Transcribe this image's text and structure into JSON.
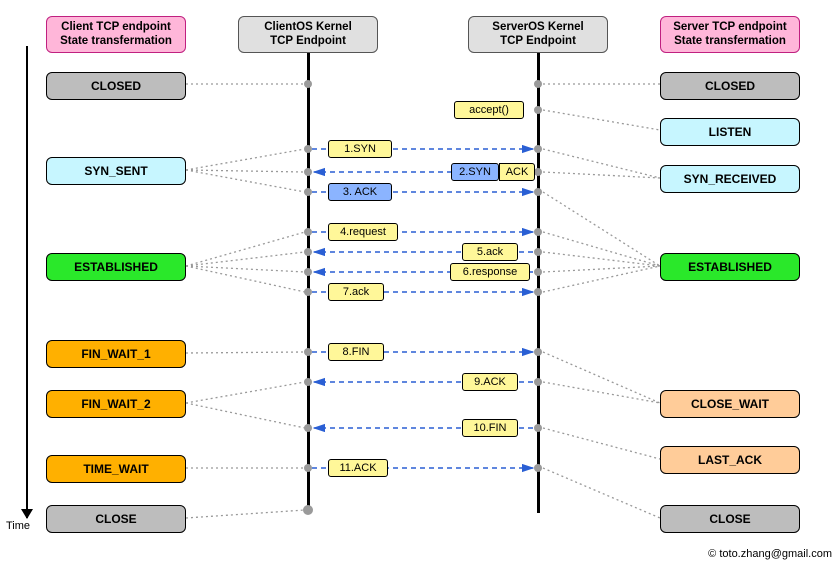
{
  "headers": {
    "client_state": "Client TCP endpoint\nState transfermation",
    "client_kernel": "ClientOS Kernel\nTCP Endpoint",
    "server_kernel": "ServerOS Kernel\nTCP Endpoint",
    "server_state": "Server TCP endpoint\nState transfermation"
  },
  "client_states": {
    "closed": "CLOSED",
    "syn_sent": "SYN_SENT",
    "established": "ESTABLISHED",
    "fin_wait_1": "FIN_WAIT_1",
    "fin_wait_2": "FIN_WAIT_2",
    "time_wait": "TIME_WAIT",
    "close": "CLOSE"
  },
  "server_states": {
    "closed": "CLOSED",
    "listen": "LISTEN",
    "syn_received": "SYN_RECEIVED",
    "established": "ESTABLISHED",
    "close_wait": "CLOSE_WAIT",
    "last_ack": "LAST_ACK",
    "close": "CLOSE"
  },
  "messages": {
    "accept": "accept()",
    "m1": "1.SYN",
    "m2a": "2.SYN",
    "m2b": "ACK",
    "m3": "3. ACK",
    "m4": "4.request",
    "m5": "5.ack",
    "m6": "6.response",
    "m7": "7.ack",
    "m8": "8.FIN",
    "m9": "9.ACK",
    "m10": "10.FIN",
    "m11": "11.ACK"
  },
  "labels": {
    "time": "Time",
    "credit": "© toto.zhang@gmail.com"
  }
}
